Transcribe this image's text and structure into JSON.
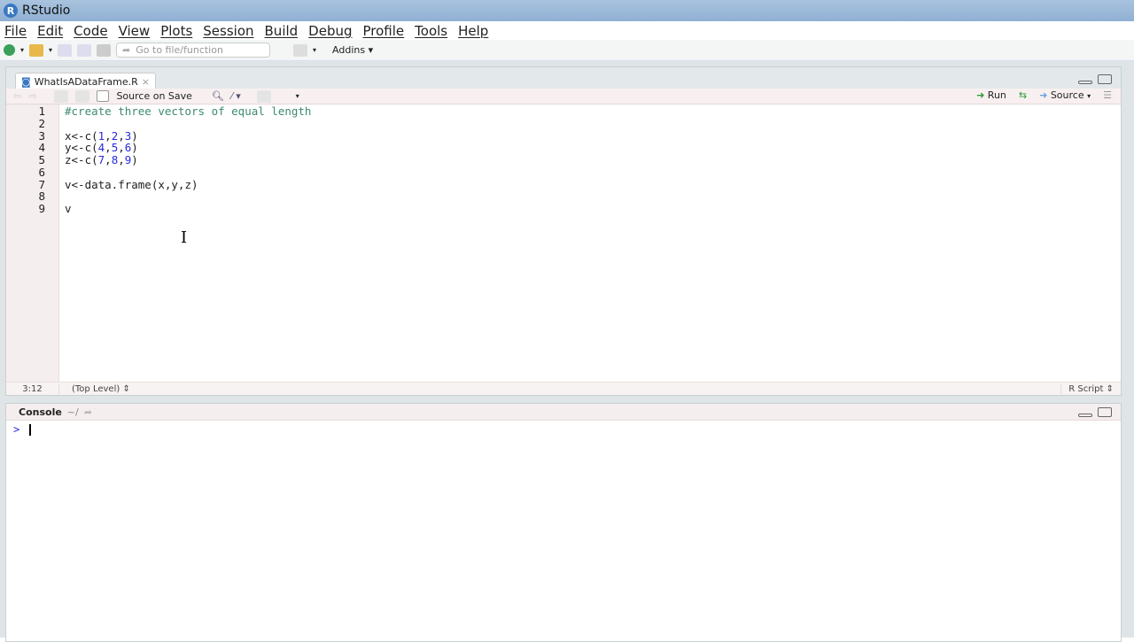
{
  "app": {
    "title": "RStudio"
  },
  "menu": [
    "File",
    "Edit",
    "Code",
    "View",
    "Plots",
    "Session",
    "Build",
    "Debug",
    "Profile",
    "Tools",
    "Help"
  ],
  "toolbar": {
    "goto_placeholder": "Go to file/function",
    "addins": "Addins"
  },
  "editor": {
    "tab": "WhatIsADataFrame.R",
    "source_on_save": "Source on Save",
    "run": "Run",
    "source": "Source",
    "lines": [
      "#create three vectors of equal length",
      "",
      "x<-c(1,2,3)",
      "y<-c(4,5,6)",
      "z<-c(7,8,9)",
      "",
      "v<-data.frame(x,y,z)",
      "",
      "v"
    ],
    "status": {
      "position": "3:12",
      "scope": "(Top Level)",
      "filetype": "R Script"
    }
  },
  "console": {
    "title": "Console",
    "path": "~/",
    "prompt": ">"
  }
}
